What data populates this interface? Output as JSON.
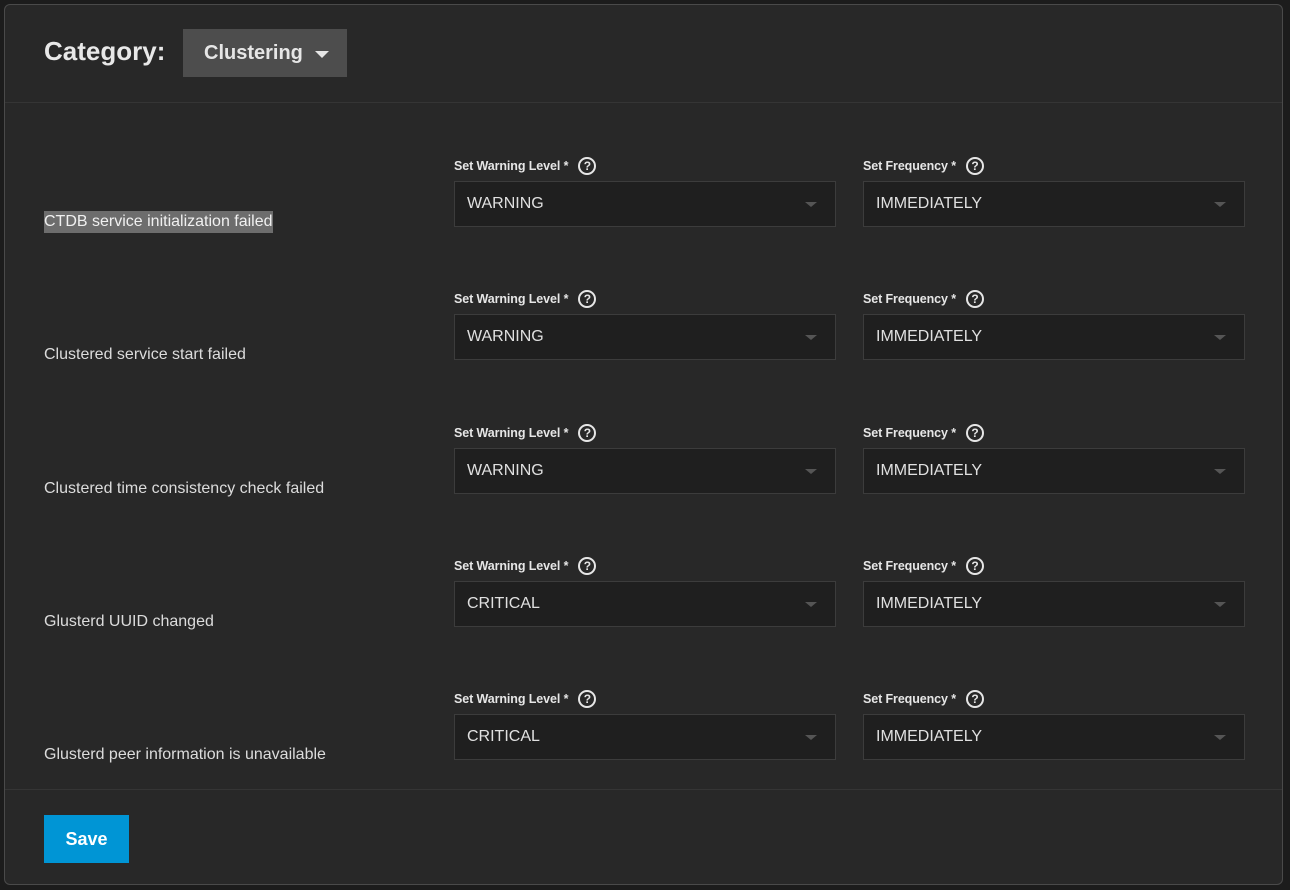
{
  "header": {
    "category_label": "Category:",
    "category_value": "Clustering"
  },
  "fields": {
    "level_label": "Set Warning Level *",
    "frequency_label": "Set Frequency *",
    "help_glyph": "?"
  },
  "alerts": [
    {
      "name": "CTDB service initialization failed",
      "level": "WARNING",
      "frequency": "IMMEDIATELY"
    },
    {
      "name": "Clustered service start failed",
      "level": "WARNING",
      "frequency": "IMMEDIATELY"
    },
    {
      "name": "Clustered time consistency check failed",
      "level": "WARNING",
      "frequency": "IMMEDIATELY"
    },
    {
      "name": "Glusterd UUID changed",
      "level": "CRITICAL",
      "frequency": "IMMEDIATELY"
    },
    {
      "name": "Glusterd peer information is unavailable",
      "level": "CRITICAL",
      "frequency": "IMMEDIATELY"
    }
  ],
  "footer": {
    "save_label": "Save"
  },
  "colors": {
    "background": "#282828",
    "accent": "#0095d5",
    "category_select": "#4d4d4d",
    "input_background": "#1f1f1f"
  },
  "icons": {
    "help": "help-circle-icon",
    "dropdown": "chevron-down-icon"
  }
}
